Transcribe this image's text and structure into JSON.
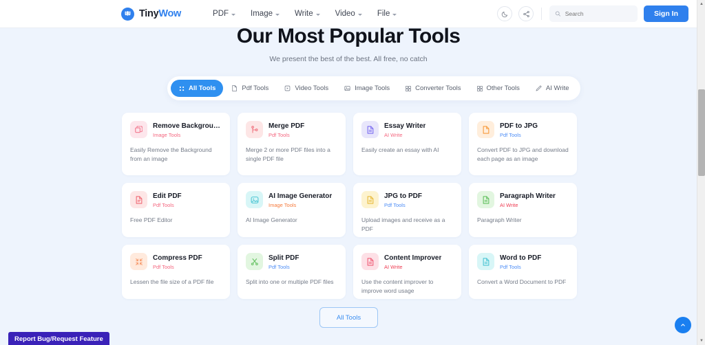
{
  "header": {
    "logo": {
      "name": "TinyWow",
      "part1": "Tiny",
      "part2": "Wow",
      "icon": "tinywow-logo-icon"
    },
    "nav": [
      {
        "label": "PDF",
        "icon": "chevron-down-icon"
      },
      {
        "label": "Image",
        "icon": "chevron-down-icon"
      },
      {
        "label": "Write",
        "icon": "chevron-down-icon"
      },
      {
        "label": "Video",
        "icon": "chevron-down-icon"
      },
      {
        "label": "File",
        "icon": "chevron-down-icon"
      }
    ],
    "dark_mode_icon": "moon-icon",
    "share_icon": "share-icon",
    "search": {
      "placeholder": "Search",
      "value": "",
      "icon": "search-icon"
    },
    "signin_label": "Sign In"
  },
  "hero": {
    "title": "Our Most Popular Tools",
    "subtitle": "We present the best of the best. All free, no catch"
  },
  "filters": [
    {
      "label": "All Tools",
      "icon": "grid-dots-icon",
      "active": true
    },
    {
      "label": "Pdf Tools",
      "icon": "pdf-file-icon",
      "active": false
    },
    {
      "label": "Video Tools",
      "icon": "video-icon",
      "active": false
    },
    {
      "label": "Image Tools",
      "icon": "image-icon",
      "active": false
    },
    {
      "label": "Converter Tools",
      "icon": "grid-squares-icon",
      "active": false
    },
    {
      "label": "Other Tools",
      "icon": "grid-squares-icon",
      "active": false
    },
    {
      "label": "AI Write",
      "icon": "pen-icon",
      "active": false
    }
  ],
  "tools": [
    {
      "title": "Remove Backgroun...",
      "category": "Image Tools",
      "category_color": "#f4667f",
      "description": "Easily Remove the Background from an image",
      "icon": "remove-background-icon",
      "icon_bg": "#fde6ec",
      "icon_color": "#f2798f"
    },
    {
      "title": "Merge PDF",
      "category": "Pdf Tools",
      "category_color": "#f4667f",
      "description": "Merge 2 or more PDF files into a single PDF file",
      "icon": "merge-icon",
      "icon_bg": "#fde6e6",
      "icon_color": "#f0717e"
    },
    {
      "title": "Essay Writer",
      "category": "AI Write",
      "category_color": "#f4667f",
      "description": "Easily create an essay with AI",
      "icon": "document-icon",
      "icon_bg": "#e8e6fb",
      "icon_color": "#7b6cf0"
    },
    {
      "title": "PDF to JPG",
      "category": "Pdf Tools",
      "category_color": "#4d8df6",
      "description": "Convert PDF to JPG and download each page as an image",
      "icon": "document-icon",
      "icon_bg": "#ffeedc",
      "icon_color": "#f79a3c"
    },
    {
      "title": "Edit PDF",
      "category": "Pdf Tools",
      "category_color": "#f4667f",
      "description": "Free PDF Editor",
      "icon": "document-edit-icon",
      "icon_bg": "#fde6e6",
      "icon_color": "#ef6a75"
    },
    {
      "title": "AI Image Generator",
      "category": "Image Tools",
      "category_color": "#f57a3c",
      "description": "AI Image Generator",
      "icon": "image-icon",
      "icon_bg": "#d8f6f7",
      "icon_color": "#4dc6d4"
    },
    {
      "title": "JPG to PDF",
      "category": "Pdf Tools",
      "category_color": "#4d8df6",
      "description": "Upload images and receive as a PDF",
      "icon": "document-icon",
      "icon_bg": "#fdf3cf",
      "icon_color": "#e8bb3c"
    },
    {
      "title": "Paragraph Writer",
      "category": "AI Write",
      "category_color": "#ee3b52",
      "description": "Paragraph Writer",
      "icon": "document-icon",
      "icon_bg": "#e2f6e0",
      "icon_color": "#63c160"
    },
    {
      "title": "Compress PDF",
      "category": "Pdf Tools",
      "category_color": "#f4667f",
      "description": "Lessen the file size of a PDF file",
      "icon": "compress-icon",
      "icon_bg": "#ffeadd",
      "icon_color": "#f79a6c"
    },
    {
      "title": "Split PDF",
      "category": "Pdf Tools",
      "category_color": "#4d8df6",
      "description": "Split into one or multiple PDF files",
      "icon": "scissors-icon",
      "icon_bg": "#e2f6e0",
      "icon_color": "#63c160"
    },
    {
      "title": "Content Improver",
      "category": "AI Write",
      "category_color": "#ee3b52",
      "description": "Use the content improver to improve word usage",
      "icon": "document-icon",
      "icon_bg": "#fde0e6",
      "icon_color": "#ef5f78"
    },
    {
      "title": "Word to PDF",
      "category": "Pdf Tools",
      "category_color": "#4d8df6",
      "description": "Convert a Word Document to PDF",
      "icon": "document-icon",
      "icon_bg": "#d8f6f7",
      "icon_color": "#4dc6d4"
    }
  ],
  "footer": {
    "all_tools_label": "All Tools",
    "report_bug_label": "Report Bug/Request Feature",
    "scroll_top_icon": "chevron-up-icon"
  },
  "colors": {
    "accent": "#2f80ed",
    "page_bg": "#eef4fd",
    "card_bg": "#ffffff",
    "report_bug_bg": "#3a22b8"
  }
}
